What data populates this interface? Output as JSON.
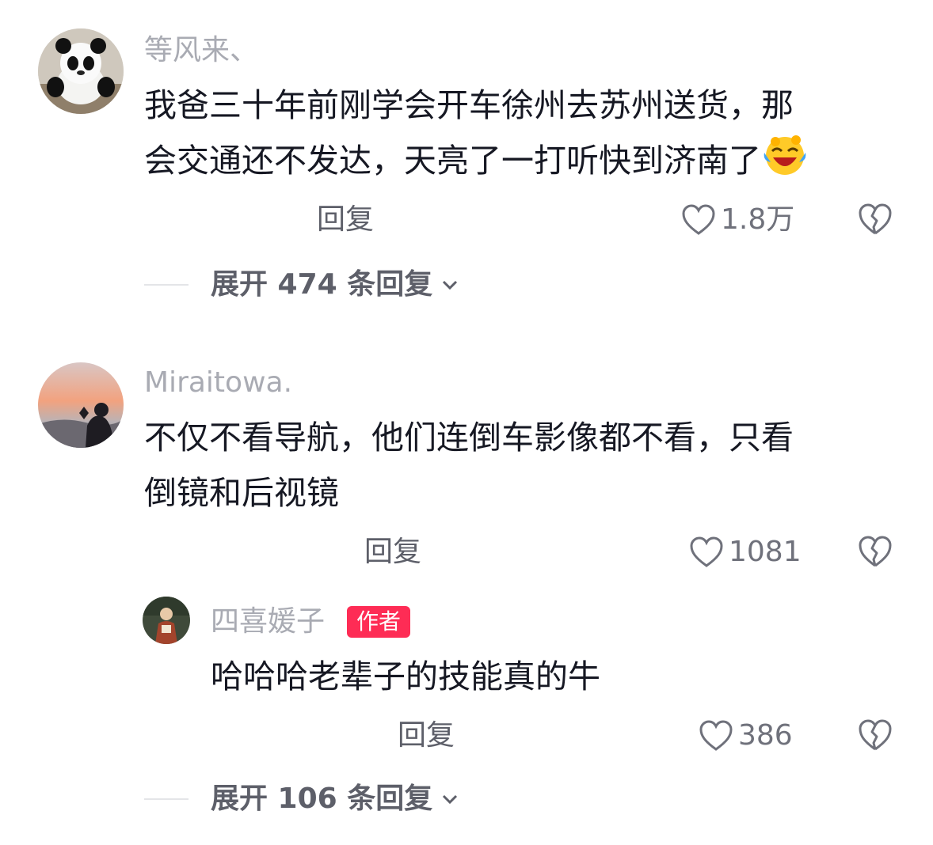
{
  "comments": [
    {
      "username": "等风来、",
      "text_line1": "我爸三十年前刚学会开车徐州去苏州送货，那",
      "text_line2": "会交通还不发达，天亮了一打听快到济南了",
      "emoji": "laughing-crying-emoji",
      "reply_label": "回复",
      "likes": "1.8万",
      "expand_label": "展开 474 条回复"
    },
    {
      "username": "Miraitowa.",
      "text_line1": "不仅不看导航，他们连倒车影像都不看，只看",
      "text_line2": "倒镜和后视镜",
      "reply_label": "回复",
      "likes": "1081",
      "reply": {
        "username": "四喜媛子",
        "author_tag": "作者",
        "text": "哈哈哈老辈子的技能真的牛",
        "reply_label": "回复",
        "likes": "386"
      },
      "expand_label": "展开 106 条回复"
    }
  ],
  "icons": {
    "like": "heart-outline-icon",
    "dislike": "broken-heart-icon",
    "expand": "chevron-down-icon"
  },
  "colors": {
    "author_tag": "#fe2c55",
    "username": "#a9abb3",
    "text": "#161823"
  }
}
